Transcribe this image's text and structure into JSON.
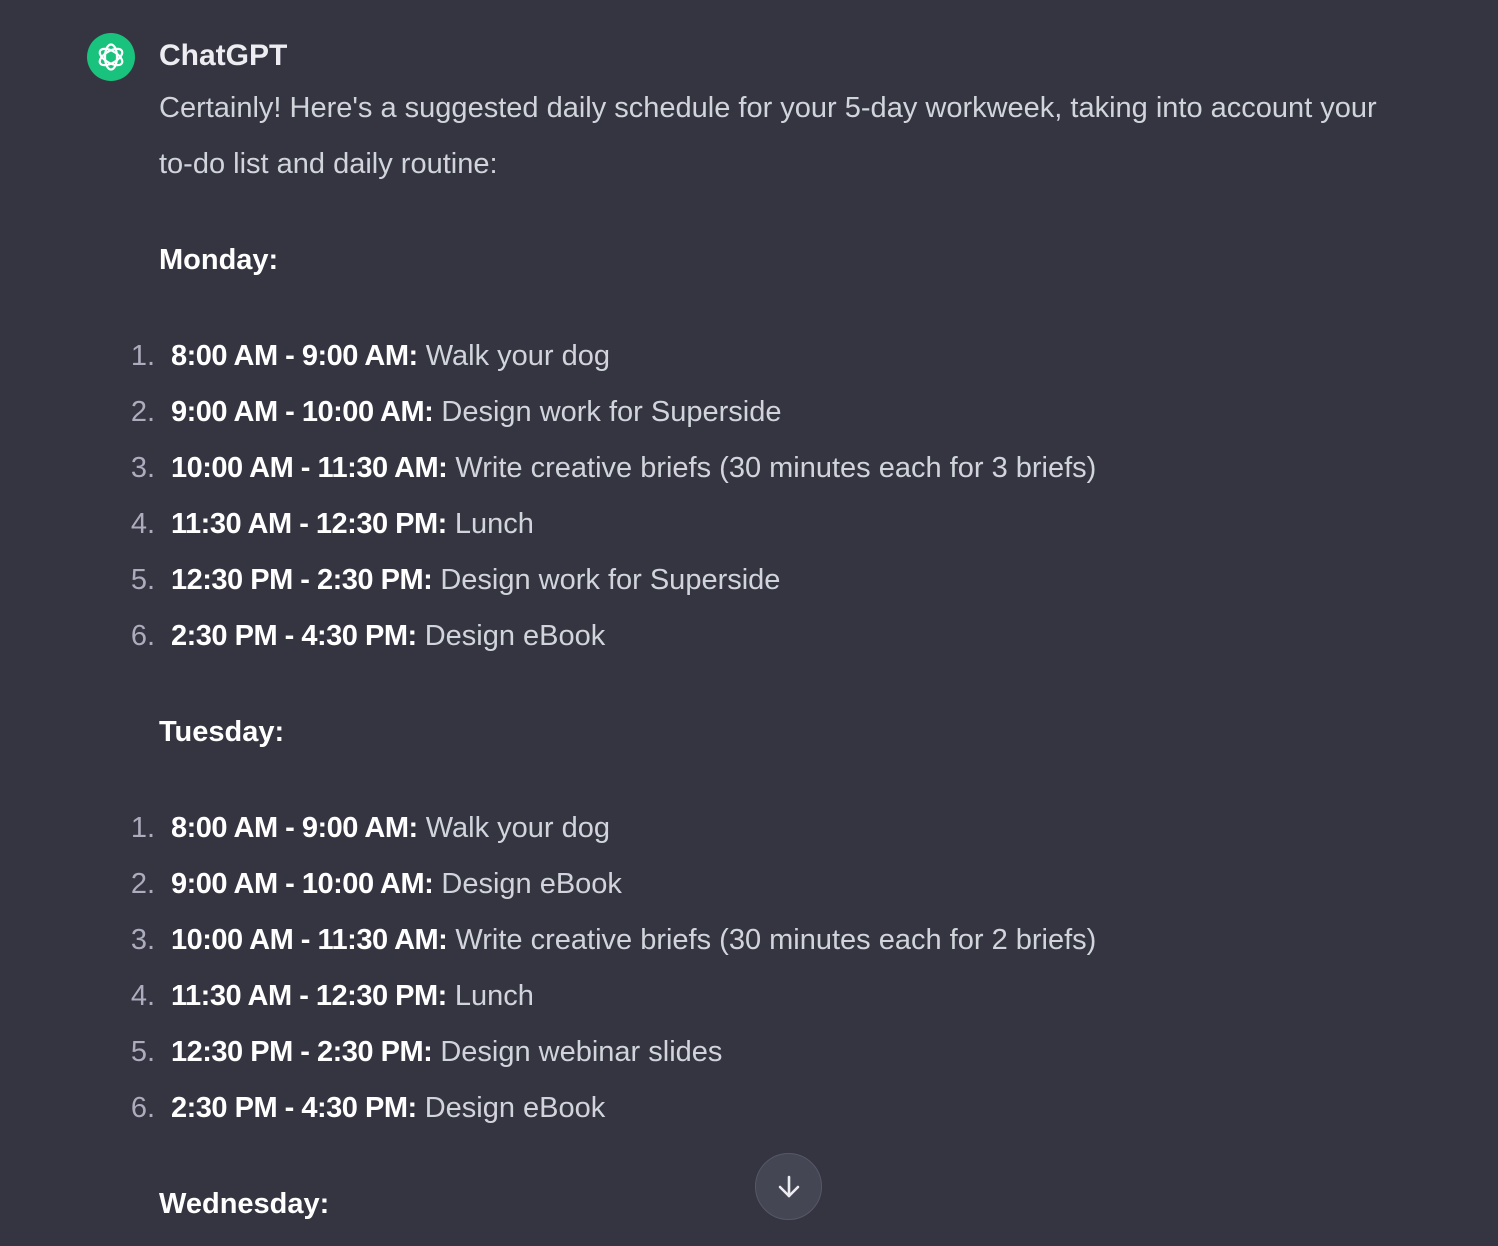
{
  "message": {
    "author": "ChatGPT",
    "avatar_icon": "openai-logo-icon",
    "avatar_color": "#19c37d",
    "intro": "Certainly! Here's a suggested daily schedule for your 5-day workweek, taking into account your to-do list and daily routine:"
  },
  "days": [
    {
      "heading": "Monday:",
      "items": [
        {
          "number": "1.",
          "time": "8:00 AM - 9:00 AM:",
          "task": "Walk your dog"
        },
        {
          "number": "2.",
          "time": "9:00 AM - 10:00 AM:",
          "task": "Design work for Superside"
        },
        {
          "number": "3.",
          "time": "10:00 AM - 11:30 AM:",
          "task": "Write creative briefs (30 minutes each for 3 briefs)"
        },
        {
          "number": "4.",
          "time": "11:30 AM - 12:30 PM:",
          "task": "Lunch"
        },
        {
          "number": "5.",
          "time": "12:30 PM - 2:30 PM:",
          "task": "Design work for Superside"
        },
        {
          "number": "6.",
          "time": "2:30 PM - 4:30 PM:",
          "task": "Design eBook"
        }
      ]
    },
    {
      "heading": "Tuesday:",
      "items": [
        {
          "number": "1.",
          "time": "8:00 AM - 9:00 AM:",
          "task": "Walk your dog"
        },
        {
          "number": "2.",
          "time": "9:00 AM - 10:00 AM:",
          "task": "Design eBook"
        },
        {
          "number": "3.",
          "time": "10:00 AM - 11:30 AM:",
          "task": "Write creative briefs (30 minutes each for 2 briefs)"
        },
        {
          "number": "4.",
          "time": "11:30 AM - 12:30 PM:",
          "task": "Lunch"
        },
        {
          "number": "5.",
          "time": "12:30 PM - 2:30 PM:",
          "task": "Design webinar slides"
        },
        {
          "number": "6.",
          "time": "2:30 PM - 4:30 PM:",
          "task": "Design eBook"
        }
      ]
    },
    {
      "heading": "Wednesday:",
      "items": []
    }
  ],
  "scroll_button": {
    "icon": "arrow-down-icon"
  },
  "colors": {
    "background": "#343541",
    "text": "#d1d5db",
    "heading": "#ffffff",
    "list_number": "#acacbe"
  }
}
